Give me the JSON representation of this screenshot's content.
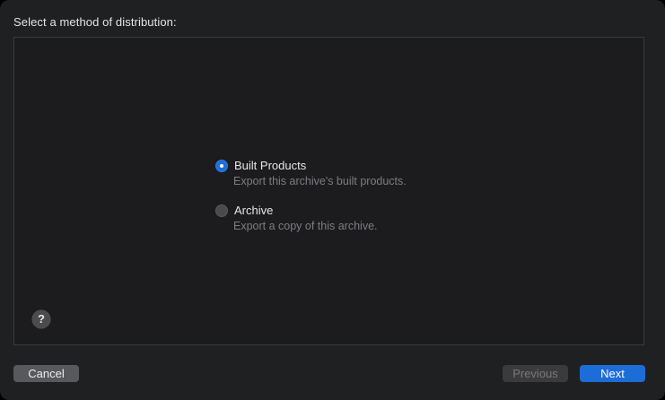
{
  "dialog": {
    "heading": "Select a method of distribution:"
  },
  "options": [
    {
      "label": "Built Products",
      "description": "Export this archive's built products.",
      "selected": true
    },
    {
      "label": "Archive",
      "description": "Export a copy of this archive.",
      "selected": false
    }
  ],
  "help": {
    "glyph": "?",
    "icon": "question-mark-icon"
  },
  "buttons": {
    "cancel": "Cancel",
    "previous": "Previous",
    "next": "Next"
  },
  "colors": {
    "accent": "#1c6dd8",
    "background": "#1f2022",
    "panel": "#1c1c1e"
  }
}
